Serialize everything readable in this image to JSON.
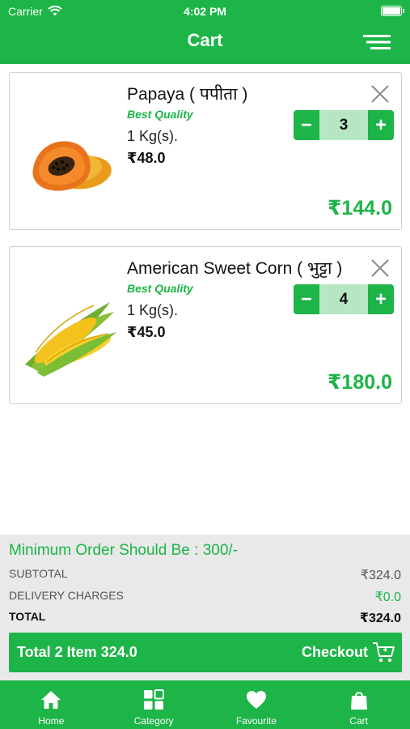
{
  "status_bar": {
    "carrier": "Carrier",
    "time": "4:02 PM"
  },
  "header": {
    "title": "Cart",
    "menu_icon": "hamburger-menu-icon"
  },
  "items": [
    {
      "name": "Papaya ( पपीता )",
      "quality": "Best Quality",
      "unit": "1 Kg(s).",
      "price": "₹48.0",
      "quantity": "3",
      "total": "₹144.0",
      "image_icon": "papaya-image"
    },
    {
      "name": "American Sweet Corn ( भुट्टा )",
      "quality": "Best Quality",
      "unit": "1 Kg(s).",
      "price": "₹45.0",
      "quantity": "4",
      "total": "₹180.0",
      "image_icon": "corn-image"
    }
  ],
  "stepper": {
    "minus": "−",
    "plus": "+"
  },
  "summary": {
    "min_order": "Minimum Order Should Be :  300/-",
    "subtotal_label": "SUBTOTAL",
    "subtotal_value": "₹324.0",
    "delivery_label": "DELIVERY CHARGES",
    "delivery_value": "₹0.0",
    "total_label": "TOTAL",
    "total_value": "₹324.0"
  },
  "checkout": {
    "total_text": "Total 2 Item 324.0",
    "label": "Checkout"
  },
  "tabs": [
    {
      "label": "Home",
      "icon": "home-icon"
    },
    {
      "label": "Category",
      "icon": "category-grid-icon"
    },
    {
      "label": "Favourite",
      "icon": "heart-icon"
    },
    {
      "label": "Cart",
      "icon": "shopping-bag-icon"
    }
  ],
  "colors": {
    "accent": "#1db448",
    "qty_bg": "#b6e7c2",
    "summary_bg": "#e9e9e9"
  }
}
